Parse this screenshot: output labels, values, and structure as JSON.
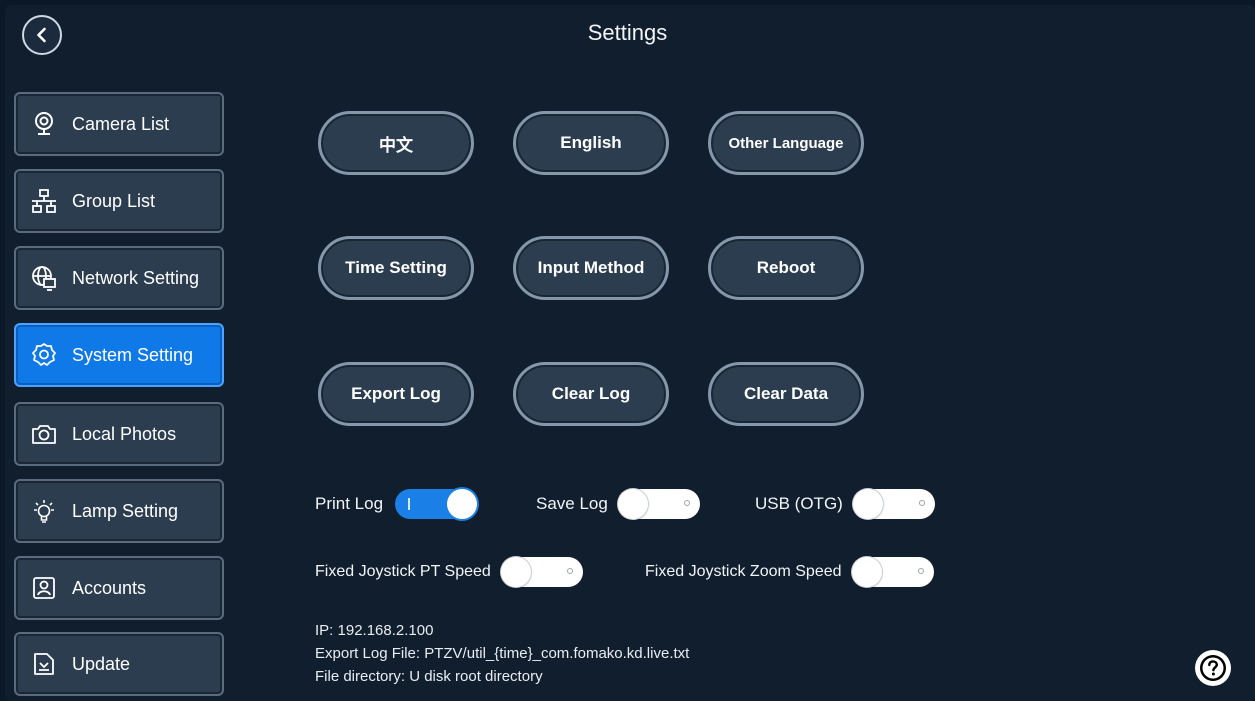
{
  "header": {
    "title": "Settings"
  },
  "sidebar": {
    "items": [
      {
        "label": "Camera List",
        "icon": "webcam-icon"
      },
      {
        "label": "Group List",
        "icon": "hierarchy-icon"
      },
      {
        "label": "Network Setting",
        "icon": "network-globe-icon"
      },
      {
        "label": "System Setting",
        "icon": "gear-icon",
        "active": true
      },
      {
        "label": "Local Photos",
        "icon": "camera-icon"
      },
      {
        "label": "Lamp Setting",
        "icon": "lightbulb-icon"
      },
      {
        "label": "Accounts",
        "icon": "account-icon"
      },
      {
        "label": "Update",
        "icon": "update-icon"
      }
    ]
  },
  "buttons": {
    "chinese": "中文",
    "english": "English",
    "other_language": "Other Language",
    "time_setting": "Time Setting",
    "input_method": "Input Method",
    "reboot": "Reboot",
    "export_log": "Export Log",
    "clear_log": "Clear Log",
    "clear_data": "Clear Data"
  },
  "toggles": {
    "print_log": {
      "label": "Print Log",
      "on": true
    },
    "save_log": {
      "label": "Save Log",
      "on": false
    },
    "usb_otg": {
      "label": "USB (OTG)",
      "on": false
    },
    "fixed_joystick_pt_speed": {
      "label": "Fixed Joystick PT Speed",
      "on": false
    },
    "fixed_joystick_zoom_speed": {
      "label": "Fixed Joystick Zoom Speed",
      "on": false
    }
  },
  "info": {
    "ip": "IP: 192.168.2.100",
    "export_log_file": "Export Log File: PTZV/util_{time}_com.fomako.kd.live.txt",
    "file_directory": "File directory: U disk root directory"
  },
  "colors": {
    "background": "#111e2e",
    "panel": "#2c3d50",
    "accent": "#1079e8"
  }
}
